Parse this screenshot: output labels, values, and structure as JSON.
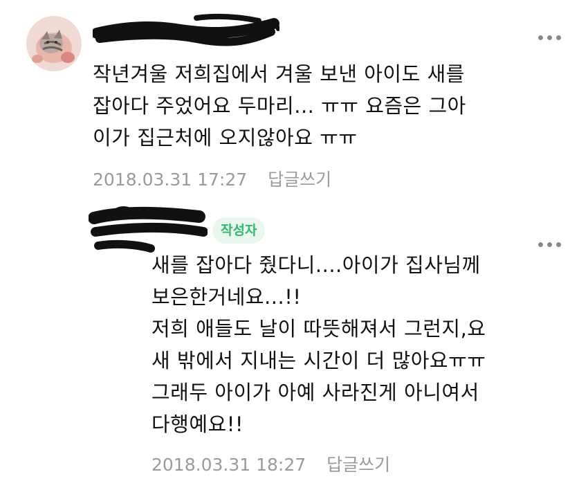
{
  "comments": [
    {
      "author_redacted": "",
      "text": "작년겨울 저희집에서 겨울 보낸 아이도 새를\n잡아다 주었어요 두마리... ㅠㅠ 요즘은 그아\n이가 집근처에 오지않아요 ㅠㅠ",
      "timestamp": "2018.03.31 17:27",
      "reply_label": "답글쓰기",
      "more_icon": "more-vertical-dots-icon"
    },
    {
      "badge": "작성자",
      "text": "새를 잡아다 줬다니....아이가 집사님께\n보은한거네요...!!\n저희 애들도 날이 따뜻해져서 그런지,요\n새 밖에서 지내는 시간이 더 많아요ㅠㅠ\n그래두 아이가 아예 사라진게 아니여서\n다행예요!!",
      "timestamp": "2018.03.31 18:27",
      "reply_label": "답글쓰기",
      "more_icon": "more-vertical-dots-icon"
    }
  ],
  "colors": {
    "badge_bg": "#e9f7ee",
    "badge_text": "#2fb96b",
    "meta_text": "#9a9a9a",
    "body_text": "#111111"
  }
}
